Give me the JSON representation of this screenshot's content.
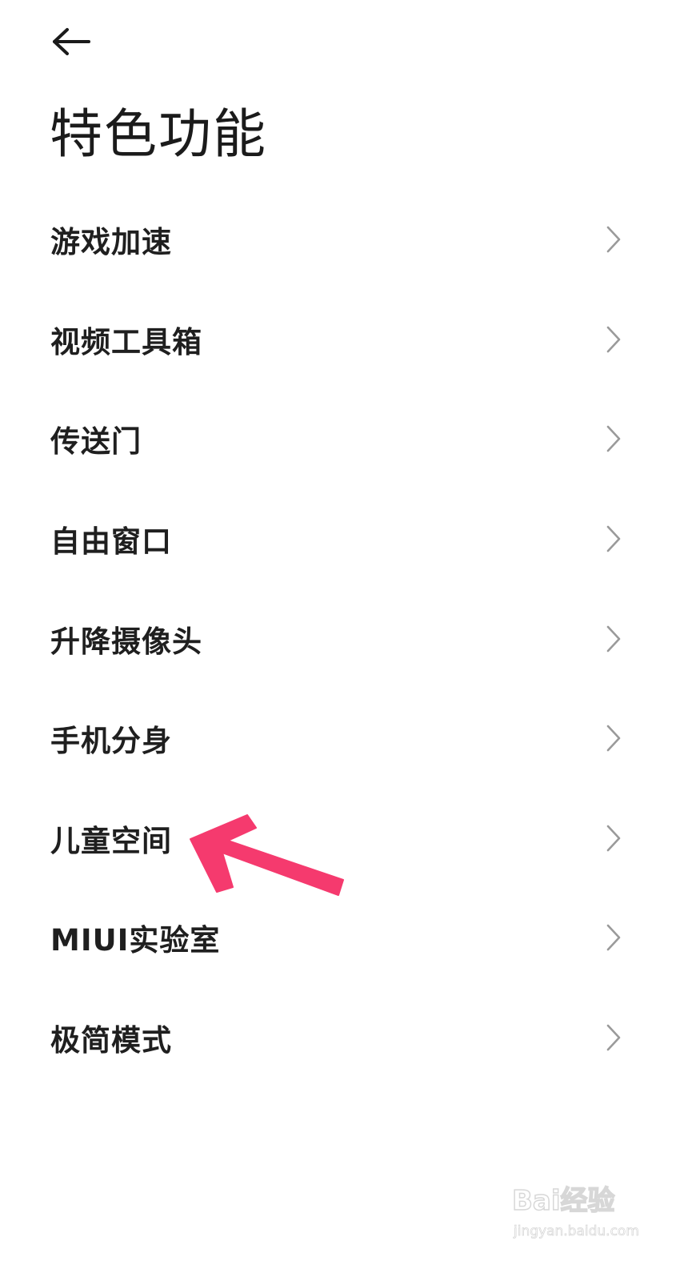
{
  "header": {
    "back_icon": "arrow-left-icon",
    "title": "特色功能"
  },
  "menu": {
    "chevron_icon": "chevron-right-icon",
    "items": [
      {
        "label": "游戏加速"
      },
      {
        "label": "视频工具箱"
      },
      {
        "label": "传送门"
      },
      {
        "label": "自由窗口"
      },
      {
        "label": "升降摄像头"
      },
      {
        "label": "手机分身"
      },
      {
        "label": "儿童空间"
      },
      {
        "label": "MIUI实验室"
      },
      {
        "label": "极简模式"
      }
    ]
  },
  "annotation": {
    "icon": "pointer-arrow-icon",
    "color": "#f53a6e",
    "target": "儿童空间"
  },
  "watermark": {
    "logo": "Bai经验",
    "url": "jingyan.baidu.com"
  },
  "colors": {
    "background": "#ffffff",
    "text": "#1f1f1f",
    "chevron": "#9a9a9a"
  }
}
